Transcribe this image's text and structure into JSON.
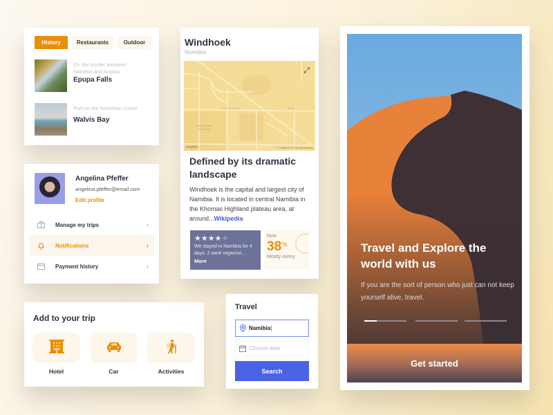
{
  "history_card": {
    "tabs": [
      {
        "label": "History",
        "active": true
      },
      {
        "label": "Restaurants",
        "active": false
      },
      {
        "label": "Outdoor",
        "active": false
      }
    ],
    "places": [
      {
        "subtitle_line1": "On the border between",
        "subtitle_line2": "Namibia and Angola",
        "name": "Epupa Falls"
      },
      {
        "subtitle_line1": "Port on the Namibian Coast",
        "subtitle_line2": "",
        "name": "Walvis Bay"
      }
    ]
  },
  "profile_card": {
    "name": "Angelina Pfeffer",
    "email": "angelina.pfeffer@email.com",
    "edit_label": "Edit profile",
    "menu": [
      {
        "label": "Manage my trips",
        "icon": "briefcase-icon",
        "active": false
      },
      {
        "label": "Notifications",
        "icon": "bell-icon",
        "active": true
      },
      {
        "label": "Payment history",
        "icon": "credit-card-icon",
        "active": false
      }
    ]
  },
  "add_trip_card": {
    "title": "Add to your trip",
    "options": [
      {
        "label": "Hotel",
        "icon": "hotel-icon"
      },
      {
        "label": "Car",
        "icon": "car-icon"
      },
      {
        "label": "Activities",
        "icon": "hiker-icon"
      }
    ]
  },
  "city_card": {
    "title": "Windhoek",
    "subtitle": "Namibia",
    "map": {
      "logo": "mapbox",
      "attribution": "© Mapbox © OpenStreetMap",
      "expand_icon": "expand-icon"
    },
    "headline": "Defined by its dramatic landscape",
    "description": "Windhoek is the capital and largest city of Namibia. It is located in central Namibia in the Khomas Highland plateau area, at around...",
    "source_link": "Wikipedia",
    "review": {
      "rating": 4,
      "max_rating": 5,
      "text": "We stayed in Namibia for 4 days; 2 were organise...",
      "more_label": "More"
    },
    "weather": {
      "label": "Now",
      "temperature": "38",
      "unit": "°c",
      "condition": "Mostly sunny"
    }
  },
  "travel_card": {
    "title": "Travel",
    "destination_value": "Namibia",
    "date_placeholder": "Choose date",
    "search_label": "Search"
  },
  "onboarding_card": {
    "title": "Travel and Explore the world with us",
    "text": "If you are the sort of person who just can not keep yourself alive, travel.",
    "pager": {
      "pages": 3,
      "current": 1,
      "current_progress": 0.3
    },
    "cta_label": "Get started"
  },
  "colors": {
    "accent_orange": "#e98f07",
    "accent_blue": "#4a63e4",
    "review_bg": "#6c7299"
  }
}
